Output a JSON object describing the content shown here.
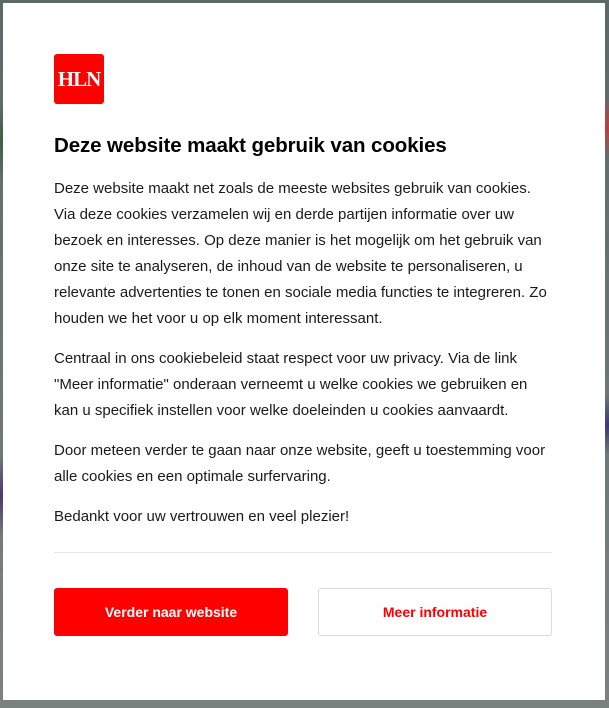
{
  "brand": {
    "logo_text": "HLN",
    "accent": "#ff0000"
  },
  "dialog": {
    "title": "Deze website maakt gebruik van cookies",
    "paragraphs": [
      "Deze website maakt net zoals de meeste websites gebruik van cookies. Via deze cookies verzamelen wij en derde partijen informatie over uw bezoek en interesses. Op deze manier is het mogelijk om het gebruik van onze site te analyseren, de inhoud van de website te personaliseren, u relevante advertenties te tonen en sociale media functies te integreren. Zo houden we het voor u op elk moment interessant.",
      "Centraal in ons cookiebeleid staat respect voor uw privacy. Via de link \"Meer informatie\" onderaan verneemt u welke cookies we gebruiken en kan u specifiek instellen voor welke doeleinden u cookies aanvaardt.",
      "Door meteen verder te gaan naar onze website, geeft u toestemming voor alle cookies en een optimale surfervaring.",
      "Bedankt voor uw vertrouwen en veel plezier!"
    ],
    "buttons": {
      "accept_label": "Verder naar website",
      "more_info_label": "Meer informatie"
    }
  }
}
